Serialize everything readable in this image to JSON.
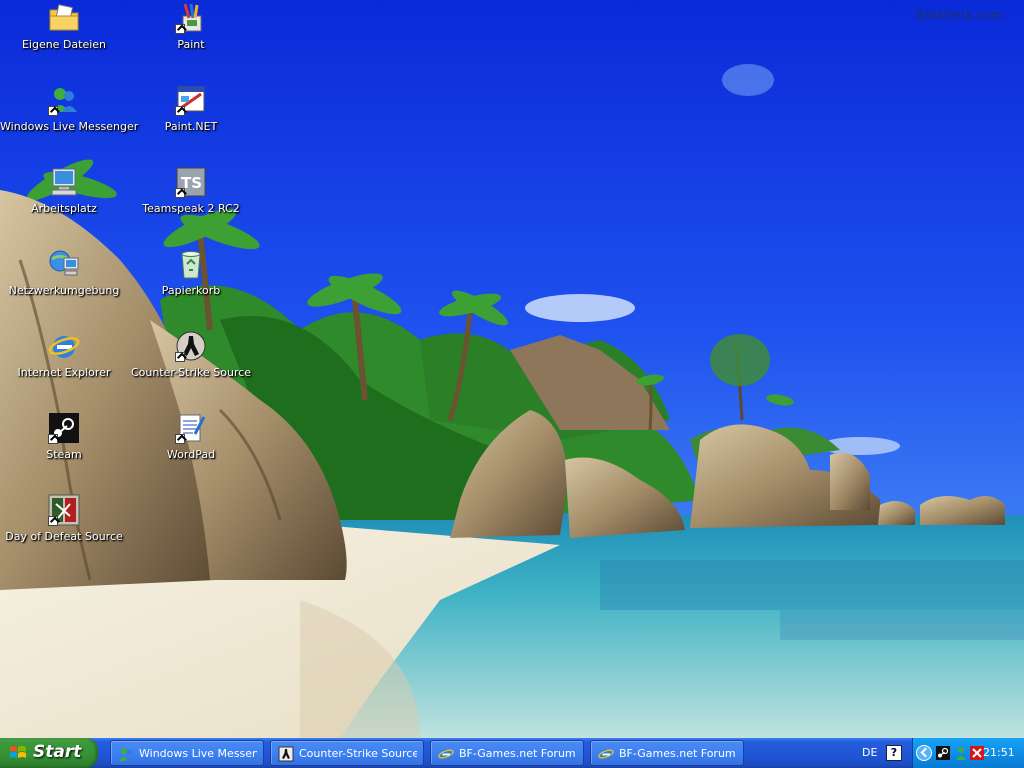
{
  "watermark": "Batkhela.com",
  "desktop_icons": {
    "eigene_dateien": "Eigene Dateien",
    "paint": "Paint",
    "messenger": "Windows Live Messenger",
    "paint_net": "Paint.NET",
    "arbeitsplatz": "Arbeitsplatz",
    "teamspeak": "Teamspeak 2 RC2",
    "netzwerk": "Netzwerkumgebung",
    "papierkorb": "Papierkorb",
    "ie": "Internet Explorer",
    "counter_strike": "Counter-Strike Source",
    "steam": "Steam",
    "wordpad": "WordPad",
    "dod": "Day of Defeat Source"
  },
  "taskbar": {
    "start_label": "Start",
    "tasks": [
      {
        "label": "Windows Live Messen...",
        "icon": "messenger-icon"
      },
      {
        "label": "Counter-Strike Source",
        "icon": "counter-strike-icon"
      },
      {
        "label": "BF-Games.net Forum ...",
        "icon": "internet-explorer-icon"
      },
      {
        "label": "BF-Games.net Forum ...",
        "icon": "internet-explorer-icon"
      }
    ],
    "language": "DE",
    "help": "?",
    "clock": "21:51"
  },
  "colors": {
    "sky": "#1436e0",
    "taskbar": "#245edb",
    "start": "#3c9a3c",
    "tray": "#0f8ee8"
  }
}
